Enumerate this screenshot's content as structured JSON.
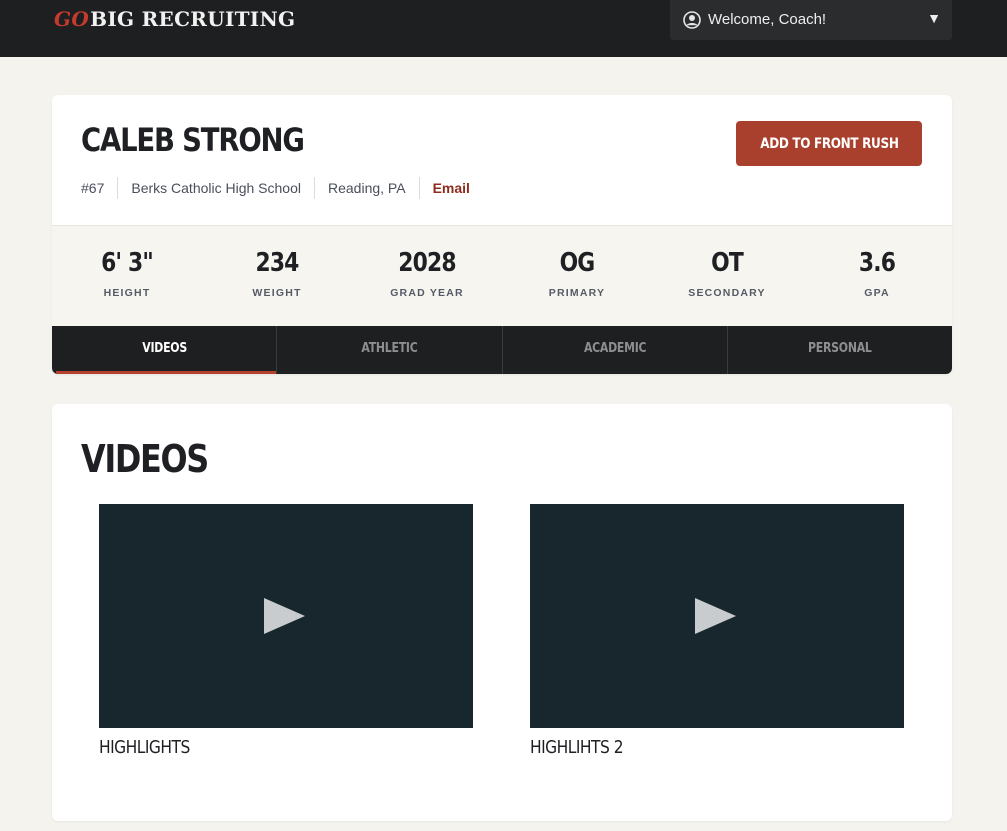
{
  "header": {
    "logo_go": "GO",
    "logo_rest": "BIG RECRUITING",
    "welcome_text": "Welcome, Coach!",
    "dropdown_icon": "triangle-down-icon"
  },
  "player": {
    "name": "CALEB STRONG",
    "number": "#67",
    "school": "Berks Catholic High School",
    "location": "Reading, PA",
    "email_label": "Email",
    "action_label": "ADD TO FRONT RUSH"
  },
  "stats": [
    {
      "value": "6' 3\"",
      "label": "HEIGHT"
    },
    {
      "value": "234",
      "label": "WEIGHT"
    },
    {
      "value": "2028",
      "label": "GRAD YEAR"
    },
    {
      "value": "OG",
      "label": "PRIMARY"
    },
    {
      "value": "OT",
      "label": "SECONDARY"
    },
    {
      "value": "3.6",
      "label": "GPA"
    }
  ],
  "tabs": [
    {
      "label": "VIDEOS",
      "active": true
    },
    {
      "label": "ATHLETIC",
      "active": false
    },
    {
      "label": "ACADEMIC",
      "active": false
    },
    {
      "label": "PERSONAL",
      "active": false
    }
  ],
  "videos": {
    "title": "VIDEOS",
    "items": [
      {
        "title": "HIGHLIGHTS"
      },
      {
        "title": "HIGHLIHTS 2"
      }
    ]
  },
  "colors": {
    "accent": "#a9402e",
    "topbar": "#1e1f21",
    "video_bg": "#18272d"
  }
}
